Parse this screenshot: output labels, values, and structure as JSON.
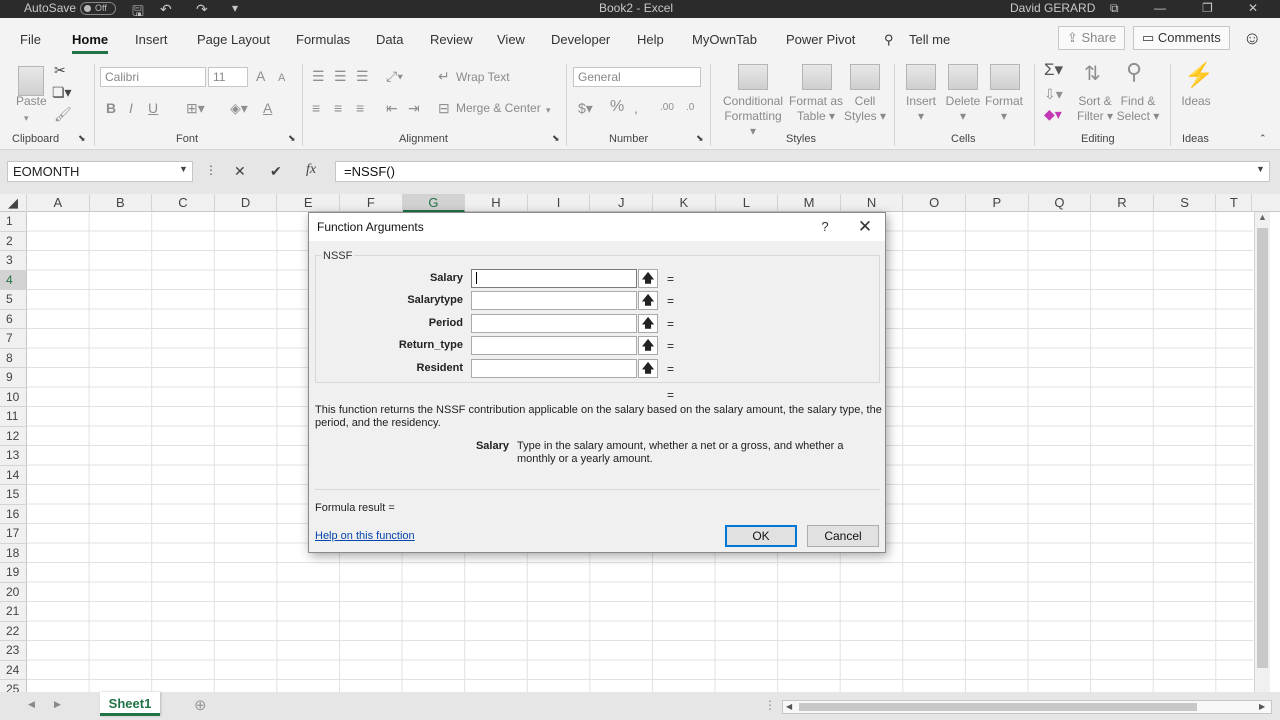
{
  "titlebar": {
    "autosave_label": "AutoSave",
    "autosave_state": "Off",
    "doc_title": "Book2  -  Excel",
    "user": "David GERARD"
  },
  "tabs": [
    "File",
    "Home",
    "Insert",
    "Page Layout",
    "Formulas",
    "Data",
    "Review",
    "View",
    "Developer",
    "Help",
    "MyOwnTab",
    "Power Pivot"
  ],
  "tell_me": "Tell me",
  "share_label": "Share",
  "comments_label": "Comments",
  "ribbon": {
    "paste": "Paste",
    "font_name": "Calibri",
    "font_size": "11",
    "font_increase": "A",
    "font_decrease": "A",
    "bold": "B",
    "italic": "I",
    "underline": "U",
    "font_color": "A",
    "wrap_text": "Wrap Text",
    "merge_center": "Merge & Center",
    "number_format": "General",
    "percent": "%",
    "cond_formatting": [
      "Conditional",
      "Formatting"
    ],
    "format_as_table": [
      "Format as",
      "Table"
    ],
    "cell_styles": [
      "Cell",
      "Styles"
    ],
    "insert": "Insert",
    "delete": "Delete",
    "format": "Format",
    "sort_filter": [
      "Sort &",
      "Filter"
    ],
    "find_select": [
      "Find &",
      "Select"
    ],
    "ideas": "Ideas",
    "groups": {
      "clipboard": "Clipboard",
      "font": "Font",
      "alignment": "Alignment",
      "number": "Number",
      "styles": "Styles",
      "cells": "Cells",
      "editing": "Editing",
      "ideas": "Ideas"
    }
  },
  "formula_bar": {
    "name_box": "EOMONTH",
    "cancel": "✕",
    "enter": "✔",
    "fx": "fx",
    "formula": "=NSSF()"
  },
  "grid": {
    "columns": [
      "A",
      "B",
      "C",
      "D",
      "E",
      "F",
      "G",
      "H",
      "I",
      "J",
      "K",
      "L",
      "M",
      "N",
      "O",
      "P",
      "Q",
      "R",
      "S",
      "T"
    ],
    "selected_column": "G",
    "rows": [
      "1",
      "2",
      "3",
      "4",
      "5",
      "6",
      "7",
      "8",
      "9",
      "10",
      "11",
      "12",
      "13",
      "14",
      "15",
      "16",
      "17",
      "18",
      "19",
      "20",
      "21",
      "22",
      "23",
      "24",
      "25"
    ],
    "selected_row": "4"
  },
  "sheet_tab": "Sheet1",
  "dialog": {
    "title": "Function Arguments",
    "help_glyph": "?",
    "function_name": "NSSF",
    "arguments": [
      {
        "label": "Salary",
        "value": ""
      },
      {
        "label": "Salarytype",
        "value": ""
      },
      {
        "label": "Period",
        "value": ""
      },
      {
        "label": "Return_type",
        "value": ""
      },
      {
        "label": "Resident",
        "value": ""
      }
    ],
    "eq": "=",
    "description": "This function returns the NSSF contribution applicable on the salary based on the salary amount, the salary type, the period, and the residency.",
    "current_arg_name": "Salary",
    "current_arg_description": "Type in the salary amount, whether a net or a gross, and whether a monthly or a yearly amount.",
    "formula_result": "Formula result =",
    "help_link": "Help on this function",
    "ok": "OK",
    "cancel": "Cancel"
  }
}
